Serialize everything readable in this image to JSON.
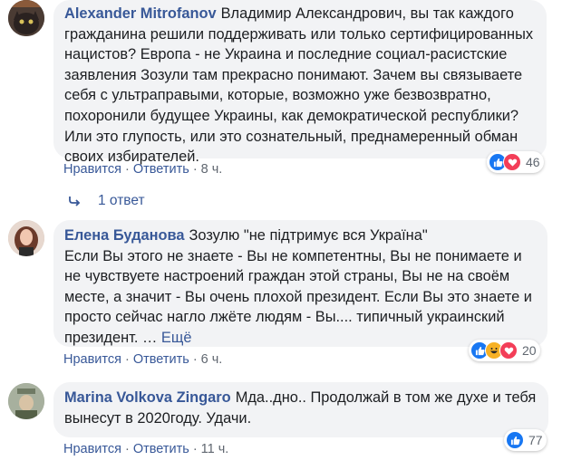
{
  "comments": [
    {
      "author": "Alexander Mitrofanov",
      "text": "Владимир Александрович, вы так каждого гражданина решили поддерживать или только сертифицированных нацистов? Европа - не Украина и последние социал-расистские заявления Зозули там прекрасно понимают. Зачем вы связываете себя с ультраправыми, которые, возможно уже безвозвратно, похоронили будущее Украины, как демократической республики? Или это глупость, или это сознательный, преднамеренный обман своих избирателей.",
      "like_label": "Нравится",
      "reply_label": "Ответить",
      "time": "8 ч.",
      "reaction_count": "46",
      "reactions": [
        "like-icon",
        "love-icon"
      ]
    },
    {
      "author": "Елена Буданова",
      "text_first": "Зозулю \"не підтримує вся Україна\"",
      "text_rest": "Если Вы этого не знаете - Вы не компетентны, Вы не понимаете и не чувствуете настроений граждан этой страны, Вы не на своём месте, а значит - Вы очень плохой президент. Если Вы это знаете и просто сейчас нагло лжёте людям - Вы.... типичный украинский президент. …",
      "more_label": "Ещё",
      "like_label": "Нравится",
      "reply_label": "Ответить",
      "time": "6 ч.",
      "reaction_count": "20",
      "reactions": [
        "like-icon",
        "haha-icon",
        "love-icon"
      ]
    },
    {
      "author": "Marina Volkova Zingaro",
      "text": "Мда..дно.. Продолжай в том же духе и тебя вынесут в 2020году. Удачи.",
      "like_label": "Нравится",
      "reply_label": "Ответить",
      "time": "11 ч.",
      "reaction_count": "77",
      "reactions": [
        "like-icon"
      ]
    }
  ],
  "replies_link": "1 ответ",
  "colors": {
    "link": "#385898",
    "bubble": "#f2f3f5",
    "like": "#1877f2",
    "love": "#f33e58",
    "haha": "#f7b125"
  }
}
